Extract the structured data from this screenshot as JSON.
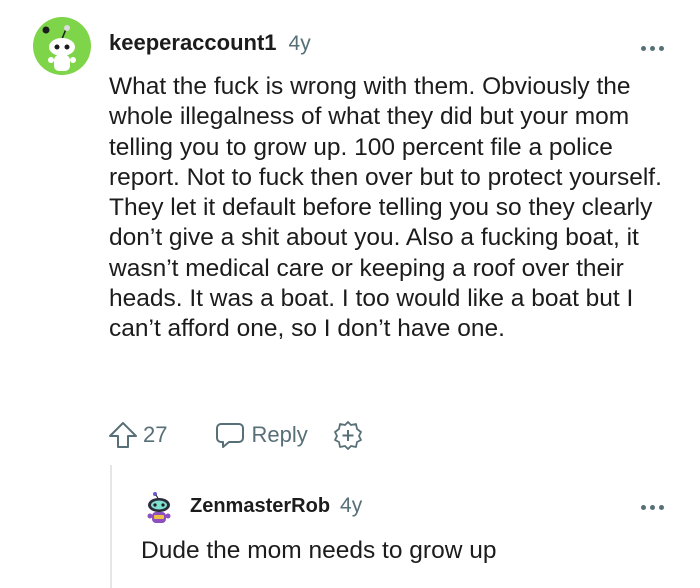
{
  "comment": {
    "username": "keeperaccount1",
    "age": "4y",
    "body": "What the fuck is wrong with them. Obviously the whole illegalness of what they did but your mom telling you to grow up. 100 percent file a police report. Not to fuck then over but to protect yourself. They let it default before telling you so they clearly don’t give a shit about you. Also a fucking boat, it wasn’t medical care or keeping a roof over their heads. It was a boat. I too would like a boat but I can’t afford one, so I don’t have one.",
    "upvotes": "27",
    "reply_label": "Reply",
    "avatar_color": "#7fd54a"
  },
  "reply": {
    "username": "ZenmasterRob",
    "age": "4y",
    "body": "Dude the mom needs to grow up"
  },
  "icons": {
    "more": "more-options-icon",
    "upvote": "upvote-arrow-icon",
    "reply": "speech-bubble-icon",
    "award": "award-plus-icon"
  },
  "colors": {
    "meta_text": "#576f76",
    "body_text": "#1c1c1c"
  }
}
